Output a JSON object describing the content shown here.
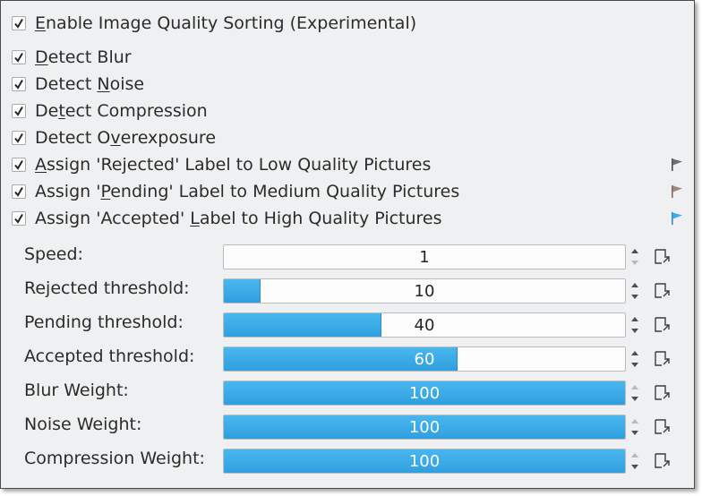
{
  "checkboxes": [
    {
      "pre": "",
      "mn": "E",
      "post": "nable Image Quality Sorting (Experimental)",
      "checked": true
    },
    {
      "pre": "",
      "mn": "D",
      "post": "etect Blur",
      "checked": true
    },
    {
      "pre": "Detect ",
      "mn": "N",
      "post": "oise",
      "checked": true
    },
    {
      "pre": "De",
      "mn": "t",
      "post": "ect Compression",
      "checked": true
    },
    {
      "pre": "Detect O",
      "mn": "v",
      "post": "erexposure",
      "checked": true
    },
    {
      "pre": "",
      "mn": "A",
      "post": "ssign 'Rejected' Label to Low Quality Pictures",
      "checked": true,
      "flag": "rejected-flag-icon",
      "flag_color": "#6e6e6e"
    },
    {
      "pre": "Assign '",
      "mn": "P",
      "post": "ending' Label to Medium Quality Pictures",
      "checked": true,
      "flag": "pending-flag-icon",
      "flag_color": "#a08779"
    },
    {
      "pre": "Assign 'Accepted' ",
      "mn": "L",
      "post": "abel to High Quality Pictures",
      "checked": true,
      "flag": "accepted-flag-icon",
      "flag_color": "#3daee9"
    }
  ],
  "settings": [
    {
      "label": "Speed:",
      "value": "1",
      "fill_fraction": 0.0
    },
    {
      "label": "Rejected threshold:",
      "value": "10",
      "fill_fraction": 0.09
    },
    {
      "label": "Pending threshold:",
      "value": "40",
      "fill_fraction": 0.39
    },
    {
      "label": "Accepted threshold:",
      "value": "60",
      "fill_fraction": 0.58
    },
    {
      "label": "Blur Weight:",
      "value": "100",
      "fill_fraction": 1.0
    },
    {
      "label": "Noise Weight:",
      "value": "100",
      "fill_fraction": 1.0
    },
    {
      "label": "Compression Weight:",
      "value": "100",
      "fill_fraction": 1.0
    }
  ],
  "colors": {
    "accent": "#3daee9",
    "panel_bg": "#eff0f1"
  },
  "icons": {
    "check": "check-icon",
    "spin_up": "spin-up-icon",
    "spin_down": "spin-down-icon",
    "reset": "reset-to-default-icon"
  }
}
